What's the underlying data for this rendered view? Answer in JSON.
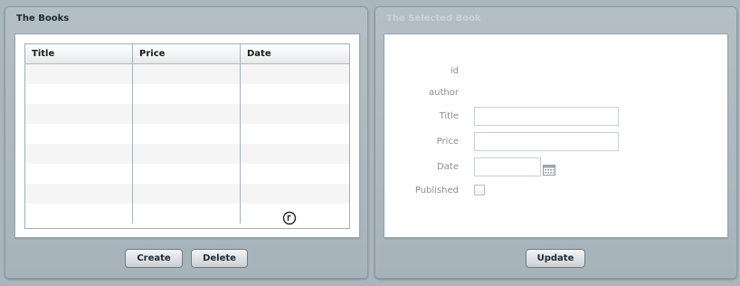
{
  "books_panel": {
    "title": "The Books",
    "columns": [
      "Title",
      "Price",
      "Date"
    ],
    "rows": [
      [
        "",
        "",
        ""
      ],
      [
        "",
        "",
        ""
      ],
      [
        "",
        "",
        ""
      ],
      [
        "",
        "",
        ""
      ],
      [
        "",
        "",
        ""
      ],
      [
        "",
        "",
        ""
      ],
      [
        "",
        "",
        ""
      ],
      [
        "",
        "",
        ""
      ]
    ],
    "create_label": "Create",
    "delete_label": "Delete"
  },
  "selected_panel": {
    "title": "The Selected Book",
    "fields": {
      "id_label": "id",
      "author_label": "author",
      "title_label": "Title",
      "price_label": "Price",
      "date_label": "Date",
      "published_label": "Published"
    },
    "values": {
      "title": "",
      "price": "",
      "date": "",
      "published": false
    },
    "update_label": "Update"
  },
  "icons": {
    "calendar": "calendar-icon",
    "cursor": "mouse-cursor-icon"
  }
}
